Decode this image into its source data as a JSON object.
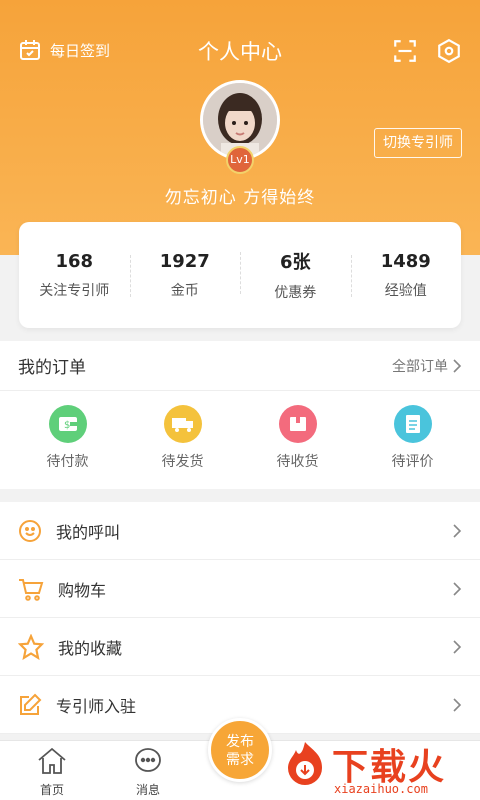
{
  "header": {
    "checkin_label": "每日签到",
    "title": "个人中心",
    "level": "Lv1",
    "switch_button": "切换专引师",
    "motto": "勿忘初心 方得始终"
  },
  "stats": [
    {
      "value": "168",
      "label": "关注专引师"
    },
    {
      "value": "1927",
      "label": "金币"
    },
    {
      "value": "6张",
      "label": "优惠券"
    },
    {
      "value": "1489",
      "label": "经验值"
    }
  ],
  "orders": {
    "title": "我的订单",
    "all_label": "全部订单",
    "items": [
      {
        "label": "待付款",
        "icon": "wallet-icon",
        "color": "#5fcf7a"
      },
      {
        "label": "待发货",
        "icon": "truck-icon",
        "color": "#f4c23c"
      },
      {
        "label": "待收货",
        "icon": "package-icon",
        "color": "#f36b7d"
      },
      {
        "label": "待评价",
        "icon": "review-icon",
        "color": "#4ac4dc"
      }
    ]
  },
  "menu": [
    {
      "label": "我的呼叫",
      "icon": "smile-icon"
    },
    {
      "label": "购物车",
      "icon": "cart-icon"
    },
    {
      "label": "我的收藏",
      "icon": "star-icon"
    },
    {
      "label": "专引师入驻",
      "icon": "edit-icon"
    }
  ],
  "tabbar": {
    "home": "首页",
    "messages": "消息",
    "publish_line1": "发布",
    "publish_line2": "需求"
  },
  "watermark": {
    "brand": "下载火",
    "url": "xiazaihuo.com"
  },
  "colors": {
    "accent": "#f6a33a",
    "watermark": "#e8411f"
  }
}
